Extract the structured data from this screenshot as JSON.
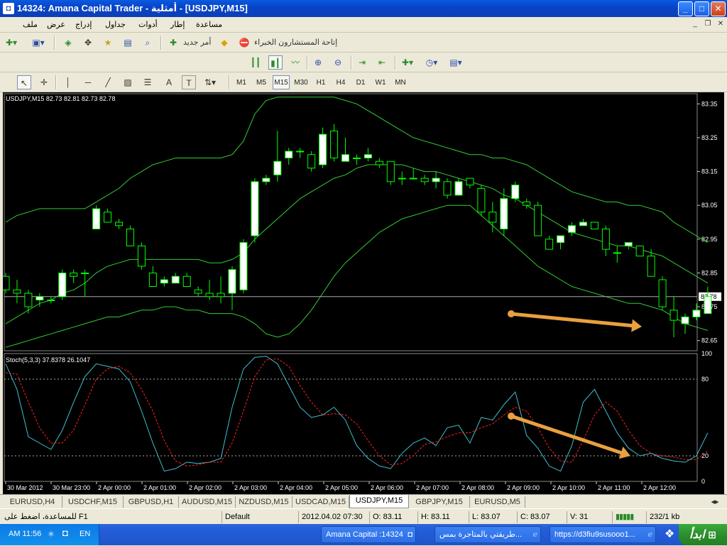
{
  "window": {
    "title": "14324: Amana Capital Trader - أمثلية - [USDJPY,M15]",
    "controls": [
      "_",
      "□",
      "✕"
    ]
  },
  "menu": {
    "items": [
      "ملف",
      "عرض",
      "إدراج",
      "جداول",
      "أدوات",
      "إطار",
      "مساعدة"
    ],
    "mdi_controls": [
      "_",
      "❐",
      "✕"
    ]
  },
  "toolbar1": {
    "new_order": "أمر جديد",
    "expert_advisors": "إتاحة المستشارون الخبراء"
  },
  "toolbar2": {
    "timeframes": [
      "M1",
      "M5",
      "M15",
      "M30",
      "H1",
      "H4",
      "D1",
      "W1",
      "MN"
    ],
    "active_timeframe": "M15",
    "tools_text": [
      "A",
      "T"
    ]
  },
  "chart": {
    "header": "USDJPY,M15  82.73 82.81 82.73 82.78",
    "current_price": "82.78",
    "stoch_header": "Stoch(5,3,3) 37.8378 26.1047",
    "price_labels": [
      "83.35",
      "83.25",
      "83.15",
      "83.05",
      "82.95",
      "82.85",
      "82.75",
      "82.65"
    ],
    "stoch_labels": [
      "100",
      "80",
      "20",
      "0"
    ],
    "time_labels": [
      "30 Mar 2012",
      "30 Mar 23:00",
      "2 Apr 00:00",
      "2 Apr 01:00",
      "2 Apr 02:00",
      "2 Apr 03:00",
      "2 Apr 04:00",
      "2 Apr 05:00",
      "2 Apr 06:00",
      "2 Apr 07:00",
      "2 Apr 08:00",
      "2 Apr 09:00",
      "2 Apr 10:00",
      "2 Apr 11:00",
      "2 Apr 12:00"
    ],
    "colors": {
      "bull": "#ffffff",
      "bear": "#000000",
      "wick": "#00ff00",
      "bands": "#32cd32",
      "stoch_main": "#40c0d0",
      "stoch_signal": "#ff2020",
      "arrow": "#e8a040"
    }
  },
  "chart_data": {
    "type": "candlestick",
    "symbol": "USDJPY",
    "timeframe": "M15",
    "ylim": [
      82.62,
      83.38
    ],
    "candles": [
      [
        82.84,
        82.85,
        82.79,
        82.8
      ],
      [
        82.8,
        82.83,
        82.76,
        82.79
      ],
      [
        82.79,
        82.8,
        82.73,
        82.75
      ],
      [
        82.77,
        82.79,
        82.75,
        82.78
      ],
      [
        82.77,
        82.78,
        82.76,
        82.77
      ],
      [
        82.78,
        82.86,
        82.77,
        82.85
      ],
      [
        82.85,
        82.86,
        82.82,
        82.84
      ],
      [
        82.85,
        82.86,
        82.78,
        82.85
      ],
      [
        82.98,
        83.05,
        82.98,
        83.04
      ],
      [
        83.03,
        83.04,
        83.0,
        83.0
      ],
      [
        83.0,
        83.01,
        82.98,
        82.99
      ],
      [
        82.98,
        82.99,
        82.93,
        82.93
      ],
      [
        82.93,
        82.94,
        82.86,
        82.87
      ],
      [
        82.85,
        82.87,
        82.81,
        82.81
      ],
      [
        82.82,
        82.84,
        82.81,
        82.83
      ],
      [
        82.82,
        82.85,
        82.82,
        82.84
      ],
      [
        82.84,
        82.85,
        82.81,
        82.81
      ],
      [
        82.8,
        82.81,
        82.78,
        82.79
      ],
      [
        82.79,
        82.83,
        82.77,
        82.78
      ],
      [
        82.79,
        82.84,
        82.76,
        82.78
      ],
      [
        82.79,
        82.87,
        82.74,
        82.86
      ],
      [
        82.8,
        82.95,
        82.79,
        82.94
      ],
      [
        82.96,
        83.13,
        82.94,
        83.12
      ],
      [
        83.12,
        83.14,
        83.11,
        83.13
      ],
      [
        83.14,
        83.27,
        83.12,
        83.18
      ],
      [
        83.19,
        83.22,
        83.17,
        83.21
      ],
      [
        83.21,
        83.22,
        83.19,
        83.21
      ],
      [
        83.2,
        83.21,
        83.15,
        83.16
      ],
      [
        83.17,
        83.28,
        83.16,
        83.26
      ],
      [
        83.27,
        83.29,
        83.18,
        83.19
      ],
      [
        83.18,
        83.25,
        83.18,
        83.2
      ],
      [
        83.19,
        83.2,
        83.17,
        83.19
      ],
      [
        83.19,
        83.22,
        83.18,
        83.2
      ],
      [
        83.18,
        83.19,
        83.16,
        83.17
      ],
      [
        83.18,
        83.18,
        83.11,
        83.12
      ],
      [
        83.13,
        83.15,
        83.11,
        83.13
      ],
      [
        83.13,
        83.16,
        83.13,
        83.13
      ],
      [
        83.13,
        83.14,
        83.11,
        83.12
      ],
      [
        83.12,
        83.15,
        83.1,
        83.13
      ],
      [
        83.12,
        83.13,
        83.07,
        83.08
      ],
      [
        83.08,
        83.13,
        83.08,
        83.12
      ],
      [
        83.13,
        83.13,
        83.1,
        83.11
      ],
      [
        83.1,
        83.11,
        83.02,
        83.03
      ],
      [
        83.03,
        83.06,
        82.97,
        83.0
      ],
      [
        82.98,
        83.1,
        82.96,
        83.07
      ],
      [
        83.07,
        83.12,
        83.06,
        83.11
      ],
      [
        83.06,
        83.07,
        83.04,
        83.05
      ],
      [
        83.05,
        83.06,
        82.96,
        82.96
      ],
      [
        82.95,
        82.96,
        82.92,
        82.92
      ],
      [
        82.94,
        82.96,
        82.92,
        82.96
      ],
      [
        82.97,
        83.0,
        82.96,
        82.99
      ],
      [
        82.99,
        83.01,
        82.99,
        83.0
      ],
      [
        83.0,
        83.0,
        82.98,
        82.98
      ],
      [
        82.98,
        82.99,
        82.9,
        82.92
      ],
      [
        82.91,
        82.93,
        82.88,
        82.91
      ],
      [
        82.93,
        82.94,
        82.92,
        82.94
      ],
      [
        82.93,
        82.93,
        82.9,
        82.9
      ],
      [
        82.9,
        82.92,
        82.84,
        82.84
      ],
      [
        82.83,
        82.84,
        82.74,
        82.75
      ],
      [
        82.74,
        82.78,
        82.66,
        82.71
      ],
      [
        82.7,
        82.73,
        82.67,
        82.72
      ],
      [
        82.72,
        82.76,
        82.71,
        82.74
      ],
      [
        82.73,
        82.81,
        82.73,
        82.78
      ]
    ],
    "stoch_k": [
      92,
      72,
      35,
      30,
      25,
      40,
      62,
      82,
      92,
      90,
      88,
      78,
      55,
      30,
      8,
      10,
      15,
      14,
      15,
      18,
      58,
      88,
      97,
      98,
      92,
      75,
      58,
      50,
      52,
      58,
      48,
      28,
      18,
      12,
      10,
      22,
      30,
      34,
      28,
      42,
      44,
      30,
      50,
      48,
      60,
      70,
      36,
      26,
      12,
      8,
      28,
      62,
      72,
      55,
      38,
      26,
      20,
      22,
      18,
      16,
      15,
      20,
      38
    ],
    "stoch_d": [
      85,
      84,
      62,
      42,
      30,
      30,
      40,
      60,
      80,
      88,
      90,
      85,
      72,
      55,
      32,
      16,
      12,
      13,
      15,
      15,
      30,
      55,
      82,
      95,
      96,
      90,
      75,
      62,
      52,
      53,
      52,
      45,
      32,
      20,
      13,
      14,
      20,
      29,
      31,
      35,
      38,
      38,
      42,
      45,
      52,
      58,
      55,
      42,
      26,
      16,
      15,
      32,
      52,
      62,
      55,
      40,
      28,
      22,
      20,
      19,
      17,
      17,
      24
    ],
    "bb_upper": [
      83.0,
      83.02,
      83.03,
      83.04,
      83.04,
      83.04,
      83.04,
      83.04,
      83.06,
      83.08,
      83.1,
      83.13,
      83.15,
      83.17,
      83.18,
      83.19,
      83.19,
      83.19,
      83.19,
      83.19,
      83.2,
      83.24,
      83.32,
      83.36,
      83.37,
      83.37,
      83.37,
      83.37,
      83.37,
      83.37,
      83.36,
      83.35,
      83.33,
      83.31,
      83.29,
      83.27,
      83.25,
      83.24,
      83.23,
      83.22,
      83.21,
      83.2,
      83.2,
      83.19,
      83.19,
      83.18,
      83.17,
      83.15,
      83.13,
      83.11,
      83.09,
      83.08,
      83.07,
      83.06,
      83.06,
      83.05,
      83.05,
      83.04,
      83.03,
      83.0,
      82.98,
      82.96,
      82.94
    ],
    "bb_mid": [
      82.7,
      82.72,
      82.74,
      82.76,
      82.77,
      82.79,
      82.8,
      82.82,
      82.85,
      82.87,
      82.88,
      82.89,
      82.89,
      82.89,
      82.89,
      82.89,
      82.89,
      82.89,
      82.88,
      82.88,
      82.89,
      82.91,
      82.95,
      82.98,
      83.01,
      83.04,
      83.07,
      83.09,
      83.11,
      83.13,
      83.14,
      83.16,
      83.17,
      83.17,
      83.17,
      83.17,
      83.16,
      83.15,
      83.15,
      83.14,
      83.13,
      83.12,
      83.11,
      83.1,
      83.08,
      83.07,
      83.05,
      83.03,
      83.01,
      82.99,
      82.97,
      82.96,
      82.95,
      82.94,
      82.93,
      82.93,
      82.92,
      82.91,
      82.9,
      82.88,
      82.86,
      82.84,
      82.82
    ],
    "bb_lower": [
      82.63,
      82.64,
      82.65,
      82.66,
      82.67,
      82.68,
      82.69,
      82.7,
      82.71,
      82.72,
      82.72,
      82.73,
      82.74,
      82.74,
      82.75,
      82.75,
      82.74,
      82.74,
      82.73,
      82.73,
      82.73,
      82.72,
      82.7,
      82.67,
      82.66,
      82.67,
      82.7,
      82.74,
      82.79,
      82.84,
      82.88,
      82.91,
      82.94,
      82.97,
      82.99,
      83.01,
      83.02,
      83.03,
      83.04,
      83.05,
      83.05,
      83.05,
      83.02,
      82.99,
      82.96,
      82.93,
      82.9,
      82.87,
      82.85,
      82.83,
      82.81,
      82.8,
      82.79,
      82.78,
      82.77,
      82.76,
      82.76,
      82.75,
      82.74,
      82.72,
      82.7,
      82.69,
      82.68
    ]
  },
  "tabs": [
    "EURUSD,H4",
    "USDCHF,M15",
    "GBPUSD,H1",
    "AUDUSD,M15",
    "NZDUSD,M15",
    "USDCAD,M15",
    "USDJPY,M15",
    "GBPJPY,M15",
    "EURUSD,M5"
  ],
  "active_tab": "USDJPY,M15",
  "status": {
    "help": "للمساعدة، اضغط على F1",
    "profile": "Default",
    "datetime": "2012.04.02 07:30",
    "open": "O: 83.11",
    "high": "H: 83.11",
    "low": "L: 83.07",
    "close": "C: 83.07",
    "volume": "V: 31",
    "traffic": "232/1 kb"
  },
  "taskbar": {
    "clock": "AM 11:56",
    "lang": "EN",
    "tasks": [
      "Amana Capital :14324",
      "طريقتي بالمتاجرة بمس...",
      "https://d3fiu9susooo1..."
    ],
    "start": "ابدأ"
  }
}
